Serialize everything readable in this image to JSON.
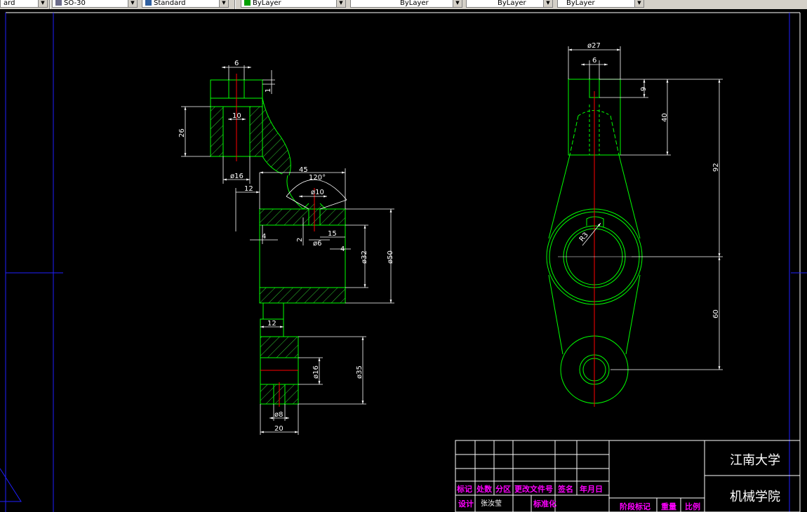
{
  "toolbar": {
    "fields": [
      {
        "label": "ard"
      },
      {
        "label": "SO-30"
      },
      {
        "label": "Standard"
      },
      {
        "label": "ByLayer"
      },
      {
        "label": "ByLayer"
      },
      {
        "label": "ByLayer"
      },
      {
        "label": "ByLayer"
      }
    ]
  },
  "colors": {
    "background": "#000000",
    "outline": "#00ff00",
    "dimension": "#ffffff",
    "centerline": "#ff0000",
    "hatch": "#33cc33",
    "titleblock_text": "#ff00ff",
    "frame": "#0000ff"
  },
  "dimensions": {
    "front": {
      "d_6": "6",
      "d_1": "1",
      "d_10": "10",
      "d_26": "26",
      "d_phi16_top": "ø16",
      "d_45": "45",
      "d_120": "120°",
      "d_12_top": "12",
      "d_phi10": "ø10",
      "d_4_left": "4",
      "d_2": "2",
      "d_phi6": "ø6",
      "d_15": "15",
      "d_4_right": "4",
      "d_phi32": "ø32",
      "d_phi50": "ø50",
      "d_12_bottom": "12",
      "d_phi16_bottom": "ø16",
      "d_phi35": "ø35",
      "d_phi8": "ø8",
      "d_20": "20"
    },
    "side": {
      "d_phi27": "ø27",
      "d_6": "6",
      "d_9": "9",
      "d_40": "40",
      "d_92": "92",
      "d_R3": "R3",
      "d_60": "60"
    }
  },
  "title_block": {
    "school": "江南大学",
    "college": "机械学院",
    "row_labels": [
      "标记",
      "处数",
      "分区",
      "更改文件号",
      "签名",
      "年月日"
    ],
    "design_label": "设计",
    "designer": "张汝莹",
    "standardize_label": "标准化",
    "stage_label": "阶段标记",
    "weight_label": "重量",
    "scale_label": "比例"
  }
}
